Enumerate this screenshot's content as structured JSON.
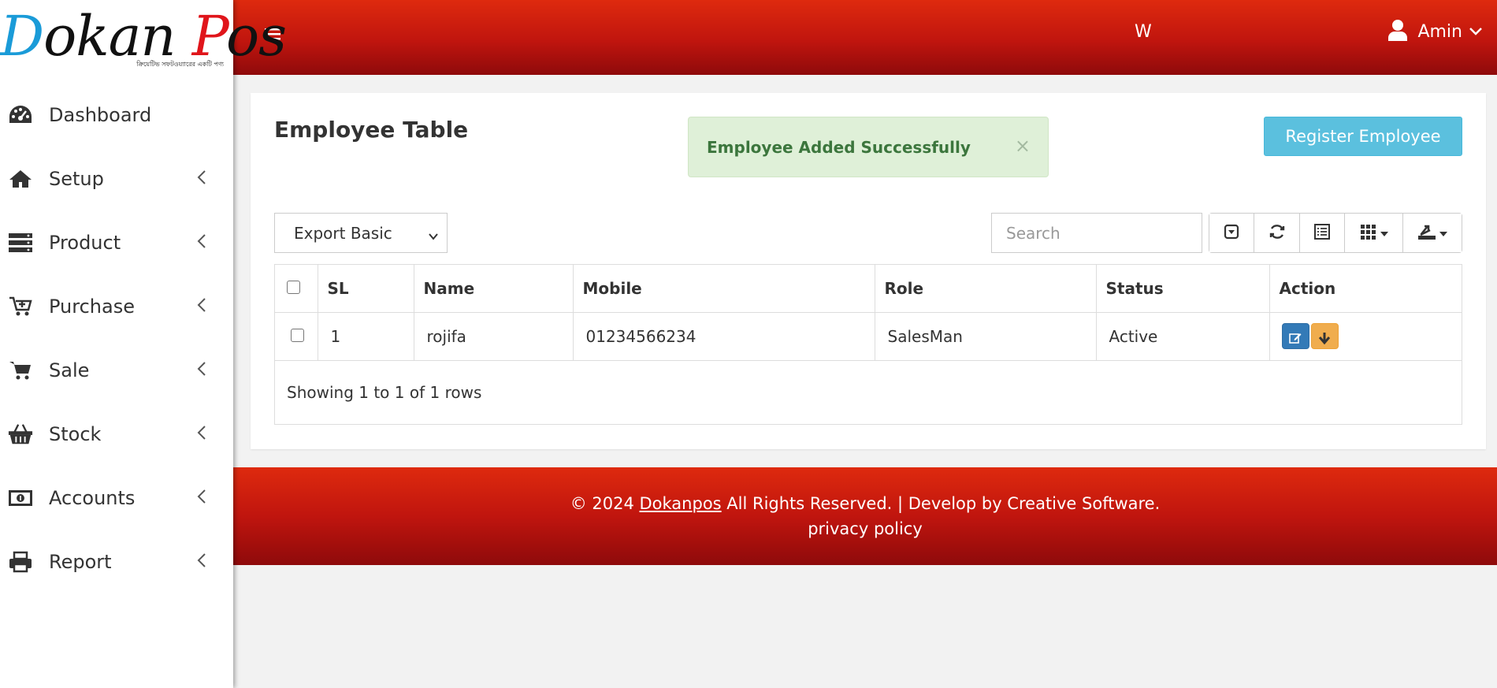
{
  "brand": {
    "logo_d": "D",
    "logo_okan": "okan ",
    "logo_p": "P",
    "logo_os": "os",
    "tagline": "ক্রিয়েটিভ সফটওয়্যারের একটি পণ্য"
  },
  "sidebar": {
    "items": [
      {
        "label": "Dashboard",
        "icon": "dashboard-icon",
        "has_submenu": false
      },
      {
        "label": "Setup",
        "icon": "home-icon",
        "has_submenu": true
      },
      {
        "label": "Product",
        "icon": "server-icon",
        "has_submenu": true
      },
      {
        "label": "Purchase",
        "icon": "cart-plus-icon",
        "has_submenu": true
      },
      {
        "label": "Sale",
        "icon": "cart-icon",
        "has_submenu": true
      },
      {
        "label": "Stock",
        "icon": "basket-icon",
        "has_submenu": true
      },
      {
        "label": "Accounts",
        "icon": "money-icon",
        "has_submenu": true
      },
      {
        "label": "Report",
        "icon": "print-icon",
        "has_submenu": true
      }
    ]
  },
  "header": {
    "mark": "W",
    "user_name": "Amin"
  },
  "main": {
    "title": "Employee Table",
    "alert": {
      "text": "Employee Added Successfully",
      "close": "×"
    },
    "register_label": "Register Employee",
    "export_select": {
      "value": "Export Basic"
    },
    "search": {
      "placeholder": "Search",
      "value": ""
    },
    "table": {
      "columns": [
        "SL",
        "Name",
        "Mobile",
        "Role",
        "Status",
        "Action"
      ],
      "rows": [
        {
          "sl": "1",
          "name": "rojifa",
          "mobile": "01234566234",
          "role": "SalesMan",
          "status": "Active"
        }
      ]
    },
    "pagination_text": "Showing 1 to 1 of 1 rows"
  },
  "footer": {
    "prefix": "© 2024 ",
    "brand_link": "Dokanpos",
    "suffix": " All Rights Reserved. | Develop by  Creative Software.",
    "privacy": "privacy policy"
  },
  "colors": {
    "header_red": "#c0150e",
    "alert_bg": "#dff0d8",
    "alert_text": "#3c763d",
    "register_btn": "#5bc0de",
    "edit_btn": "#337ab7",
    "download_btn": "#f0ad4e"
  }
}
